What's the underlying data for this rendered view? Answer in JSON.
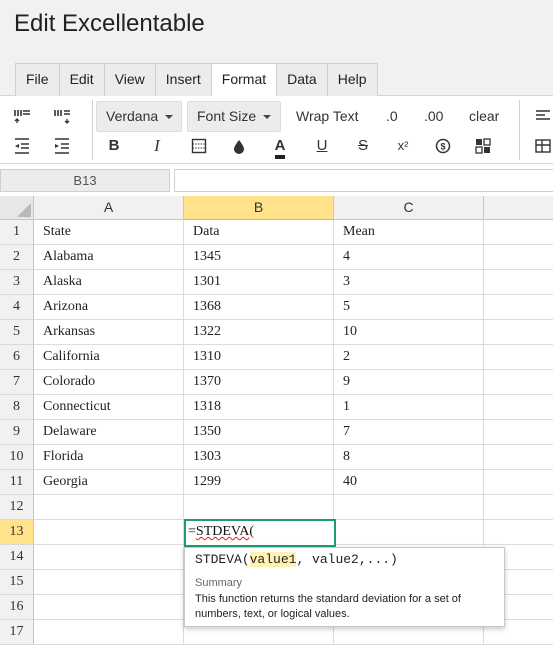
{
  "app": {
    "title": "Edit Excellentable"
  },
  "menu": {
    "tabs": [
      "File",
      "Edit",
      "View",
      "Insert",
      "Format",
      "Data",
      "Help"
    ],
    "active": "Format"
  },
  "toolbar": {
    "font_family": "Verdana",
    "font_size_label": "Font Size",
    "wrap_text": "Wrap Text",
    "decrease_decimals": ".0",
    "increase_decimals": ".00",
    "clear": "clear",
    "bold": "B",
    "italic": "I",
    "text_color": "A",
    "underline": "U",
    "strikethrough": "S",
    "superscript": "x²",
    "icons": [
      "insert-row-above-icon",
      "insert-row-below-icon",
      "indent-decrease-icon",
      "indent-increase-icon",
      "cell-border-icon",
      "fill-color-icon",
      "currency-icon",
      "conditional-format-icon",
      "align-left-icon",
      "table-icon"
    ]
  },
  "formula_bar": {
    "cell_ref": "B13",
    "value": ""
  },
  "sheet": {
    "columns": [
      "A",
      "B",
      "C"
    ],
    "selected_column": "B",
    "selected_row": 13,
    "rows": [
      {
        "num": "1",
        "cells": [
          "State",
          "Data",
          "Mean"
        ]
      },
      {
        "num": "2",
        "cells": [
          "Alabama",
          "1345",
          "4"
        ]
      },
      {
        "num": "3",
        "cells": [
          "Alaska",
          "1301",
          "3"
        ]
      },
      {
        "num": "4",
        "cells": [
          "Arizona",
          "1368",
          "5"
        ]
      },
      {
        "num": "5",
        "cells": [
          "Arkansas",
          "1322",
          "10"
        ]
      },
      {
        "num": "6",
        "cells": [
          "California",
          "1310",
          "2"
        ]
      },
      {
        "num": "7",
        "cells": [
          "Colorado",
          "1370",
          "9"
        ]
      },
      {
        "num": "8",
        "cells": [
          "Connecticut",
          "1318",
          "1"
        ]
      },
      {
        "num": "9",
        "cells": [
          "Delaware",
          "1350",
          "7"
        ]
      },
      {
        "num": "10",
        "cells": [
          "Florida",
          "1303",
          "8"
        ]
      },
      {
        "num": "11",
        "cells": [
          "Georgia",
          "1299",
          "40"
        ]
      },
      {
        "num": "12",
        "cells": [
          "",
          "",
          ""
        ]
      },
      {
        "num": "13",
        "cells": [
          "",
          "",
          ""
        ]
      },
      {
        "num": "14",
        "cells": [
          "",
          "",
          ""
        ]
      },
      {
        "num": "15",
        "cells": [
          "",
          "",
          ""
        ]
      },
      {
        "num": "16",
        "cells": [
          "",
          "",
          ""
        ]
      },
      {
        "num": "17",
        "cells": [
          "",
          "",
          ""
        ]
      }
    ]
  },
  "editor": {
    "prefix": "=",
    "function": "STDEVA",
    "suffix": "("
  },
  "tooltip": {
    "fn_name": "STDEVA",
    "open_paren": "(",
    "current_arg": "value1",
    "rest_args": ", value2,...)",
    "summary_label": "Summary",
    "description": "This function returns the standard deviation for a set of numbers, text, or logical values."
  },
  "colors": {
    "selected_header": "#ffe28a",
    "active_cell_border": "#1e9a76",
    "arg_highlight": "#fff3b3"
  }
}
